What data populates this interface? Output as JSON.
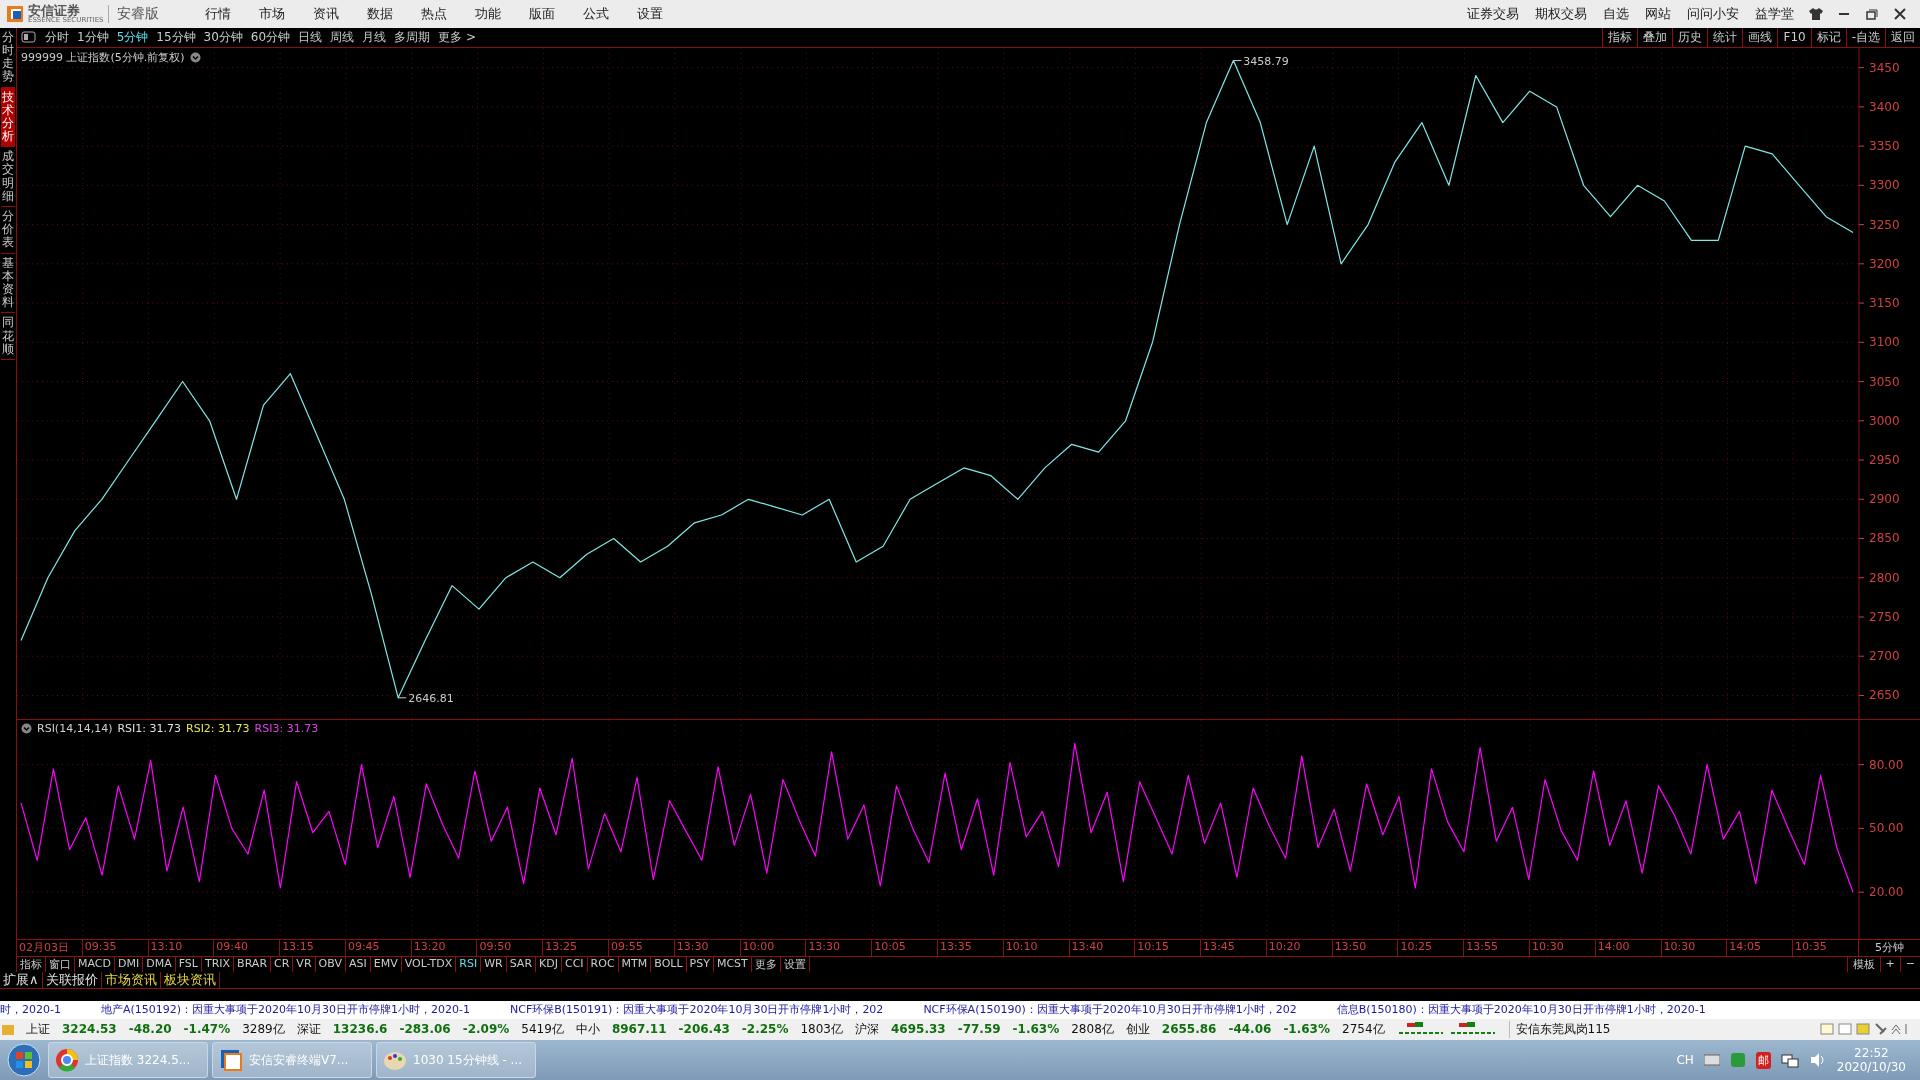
{
  "titlebar": {
    "logo": "安信证券",
    "logo_sub": "ESSENCE SECURITIES",
    "edition": "安睿版",
    "menus": [
      "行情",
      "市场",
      "资讯",
      "数据",
      "热点",
      "功能",
      "版面",
      "公式",
      "设置"
    ],
    "links": [
      "证券交易",
      "期权交易",
      "自选",
      "网站",
      "问问小安",
      "益学堂"
    ]
  },
  "side_tabs": [
    {
      "label": "分时走势",
      "selected": false
    },
    {
      "label": "技术分析",
      "selected": true
    },
    {
      "label": "成交明细",
      "selected": false
    },
    {
      "label": "分价表",
      "selected": false
    },
    {
      "label": "基本资料",
      "selected": false
    },
    {
      "label": "同花顺",
      "selected": false
    }
  ],
  "toolbar": {
    "periods": [
      {
        "label": "分时",
        "selected": false
      },
      {
        "label": "1分钟",
        "selected": false
      },
      {
        "label": "5分钟",
        "selected": true
      },
      {
        "label": "15分钟",
        "selected": false
      },
      {
        "label": "30分钟",
        "selected": false
      },
      {
        "label": "60分钟",
        "selected": false
      },
      {
        "label": "日线",
        "selected": false
      },
      {
        "label": "周线",
        "selected": false
      },
      {
        "label": "月线",
        "selected": false
      },
      {
        "label": "多周期",
        "selected": false
      },
      {
        "label": "更多 >",
        "selected": false
      }
    ],
    "actions": [
      "指标",
      "叠加",
      "历史",
      "统计",
      "画线",
      "F10",
      "标记",
      "-自选",
      "返回"
    ]
  },
  "price_pane": {
    "title": "999999 上证指数(5分钟.前复权)",
    "chart_data": {
      "type": "line",
      "grid": true,
      "ylim": [
        2620,
        3475
      ],
      "yticks": [
        2650,
        2700,
        2750,
        2800,
        2850,
        2900,
        2950,
        3000,
        3050,
        3100,
        3150,
        3200,
        3250,
        3300,
        3350,
        3400,
        3450
      ],
      "series": [
        {
          "color": "#7fe8e8",
          "values": [
            2720,
            2800,
            2860,
            2900,
            2950,
            3000,
            3050,
            3000,
            2900,
            3020,
            3060,
            2980,
            2900,
            2780,
            2647,
            2720,
            2790,
            2760,
            2800,
            2820,
            2800,
            2830,
            2850,
            2820,
            2840,
            2870,
            2880,
            2900,
            2890,
            2880,
            2900,
            2820,
            2840,
            2900,
            2920,
            2940,
            2930,
            2900,
            2940,
            2970,
            2960,
            3000,
            3100,
            3250,
            3380,
            3459,
            3380,
            3250,
            3350,
            3200,
            3250,
            3330,
            3380,
            3300,
            3440,
            3380,
            3420,
            3400,
            3300,
            3260,
            3300,
            3280,
            3230,
            3230,
            3350,
            3340,
            3300,
            3260,
            3240
          ]
        }
      ],
      "annotations": [
        "3458.79",
        "2646.81"
      ]
    }
  },
  "rsi_pane": {
    "legend": [
      {
        "text": "RSI(14,14,14)",
        "color": "#d0d0d0"
      },
      {
        "text": "RSI1: 31.73",
        "color": "#e0e0e0"
      },
      {
        "text": "RSI2: 31.73",
        "color": "#e8e84a"
      },
      {
        "text": "RSI3: 31.73",
        "color": "#e040e0"
      }
    ],
    "chart_data": {
      "type": "line",
      "grid": true,
      "ylim": [
        -2,
        101
      ],
      "yticks": [
        {
          "value": 20,
          "label": "20.00"
        },
        {
          "value": 50,
          "label": "50.00"
        },
        {
          "value": 80,
          "label": "80.00"
        }
      ],
      "series": [
        {
          "color": "#ff00ff",
          "values": [
            62,
            35,
            78,
            40,
            55,
            28,
            70,
            45,
            82,
            30,
            60,
            25,
            75,
            50,
            38,
            68,
            22,
            72,
            48,
            58,
            33,
            80,
            41,
            65,
            27,
            71,
            52,
            36,
            77,
            44,
            60,
            24,
            69,
            47,
            83,
            31,
            57,
            39,
            74,
            26,
            63,
            49,
            35,
            79,
            42,
            66,
            29,
            73,
            54,
            37,
            86,
            45,
            61,
            23,
            70,
            50,
            34,
            76,
            40,
            64,
            28,
            81,
            46,
            58,
            32,
            90,
            48,
            67,
            25,
            72,
            55,
            38,
            75,
            43,
            62,
            27,
            69,
            51,
            36,
            84,
            41,
            59,
            30,
            71,
            47,
            65,
            22,
            78,
            53,
            39,
            88,
            44,
            60,
            26,
            73,
            49,
            35,
            77,
            42,
            63,
            29,
            70,
            56,
            38,
            80,
            45,
            58,
            24,
            68,
            50,
            33,
            75,
            41,
            20
          ]
        }
      ]
    }
  },
  "time_axis": {
    "labels": [
      "02月03日",
      "09:35",
      "13:10",
      "09:40",
      "13:15",
      "09:45",
      "13:20",
      "09:50",
      "13:25",
      "09:55",
      "13:30",
      "10:00",
      "13:30",
      "10:05",
      "13:35",
      "10:10",
      "13:40",
      "10:15",
      "13:45",
      "10:20",
      "13:50",
      "10:25",
      "13:55",
      "10:30",
      "14:00",
      "10:30",
      "14:05",
      "10:35"
    ],
    "period": "5分钟"
  },
  "indicator_tabs": [
    {
      "label": "指标",
      "selected": false
    },
    {
      "label": "窗口",
      "selected": false
    },
    {
      "label": "MACD",
      "selected": false
    },
    {
      "label": "DMI",
      "selected": false
    },
    {
      "label": "DMA",
      "selected": false
    },
    {
      "label": "FSL",
      "selected": false
    },
    {
      "label": "TRIX",
      "selected": false
    },
    {
      "label": "BRAR",
      "selected": false
    },
    {
      "label": "CR",
      "selected": false
    },
    {
      "label": "VR",
      "selected": false
    },
    {
      "label": "OBV",
      "selected": false
    },
    {
      "label": "ASI",
      "selected": false
    },
    {
      "label": "EMV",
      "selected": false
    },
    {
      "label": "VOL-TDX",
      "selected": false
    },
    {
      "label": "RSI",
      "selected": true
    },
    {
      "label": "WR",
      "selected": false
    },
    {
      "label": "SAR",
      "selected": false
    },
    {
      "label": "KDJ",
      "selected": false
    },
    {
      "label": "CCI",
      "selected": false
    },
    {
      "label": "ROC",
      "selected": false
    },
    {
      "label": "MTM",
      "selected": false
    },
    {
      "label": "BOLL",
      "selected": false
    },
    {
      "label": "PSY",
      "selected": false
    },
    {
      "label": "MCST",
      "selected": false
    },
    {
      "label": "更多",
      "selected": false
    },
    {
      "label": "设置",
      "selected": false
    }
  ],
  "indicator_controls": [
    "模板",
    "+",
    "−"
  ],
  "extension_tabs": [
    {
      "label": "扩展∧",
      "color": "#e0e0e0"
    },
    {
      "label": "关联报价",
      "color": "#e0e0e0"
    },
    {
      "label": "市场资讯",
      "color": "#e8d840"
    },
    {
      "label": "板块资讯",
      "color": "#e8d840"
    }
  ],
  "ticker": [
    "时，2020-1",
    "地产A(150192)：因重大事项于2020年10月30日开市停牌1小时，2020-1",
    "NCF环保B(150191)：因重大事项于2020年10月30日开市停牌1小时，202",
    "NCF环保A(150190)：因重大事项于2020年10月30日开市停牌1小时，202",
    "信息B(150180)：因重大事项于2020年10月30日开市停牌1小时，2020-1"
  ],
  "indices": [
    {
      "name": "上证",
      "price": "3224.53",
      "change": "-48.20",
      "percent": "-1.47%",
      "amount": "3289亿"
    },
    {
      "name": "深证",
      "price": "13236.6",
      "change": "-283.06",
      "percent": "-2.09%",
      "amount": "5419亿"
    },
    {
      "name": "中小",
      "price": "8967.11",
      "change": "-206.43",
      "percent": "-2.25%",
      "amount": "1803亿"
    },
    {
      "name": "沪深",
      "price": "4695.33",
      "change": "-77.59",
      "percent": "-1.63%",
      "amount": "2808亿"
    },
    {
      "name": "创业",
      "price": "2655.86",
      "change": "-44.06",
      "percent": "-1.63%",
      "amount": "2754亿"
    }
  ],
  "branch": "安信东莞凤岗115",
  "taskbar": {
    "tasks": [
      "上证指数 3224.5...",
      "安信安睿终端V7...",
      "1030 15分钟线 - ..."
    ],
    "input_lang": "CH",
    "ime": "邮",
    "time": "22:52",
    "date": "2020/10/30"
  }
}
